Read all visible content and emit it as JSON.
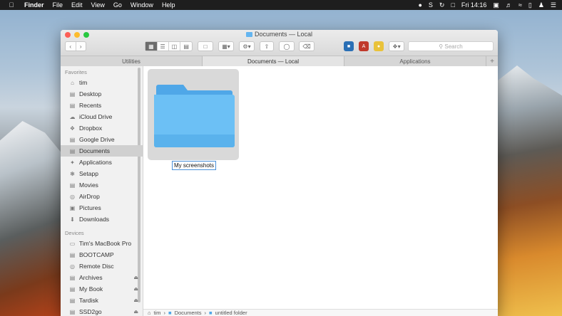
{
  "menubar": {
    "app": "Finder",
    "items": [
      "File",
      "Edit",
      "View",
      "Go",
      "Window",
      "Help"
    ],
    "clock": "Fri 14:16"
  },
  "window": {
    "title": "Documents — Local",
    "search_placeholder": "Search",
    "tabs": [
      "Utilities",
      "Documents — Local",
      "Applications"
    ],
    "tab_add": "+"
  },
  "sidebar": {
    "favorites_header": "Favorites",
    "favorites": [
      "tim",
      "Desktop",
      "Recents",
      "iCloud Drive",
      "Dropbox",
      "Google Drive",
      "Documents",
      "Applications",
      "Setapp",
      "Movies",
      "AirDrop",
      "Pictures",
      "Downloads"
    ],
    "selected": "Documents",
    "devices_header": "Devices",
    "devices": [
      "Tim's MacBook Pro",
      "BOOTCAMP",
      "Remote Disc",
      "Archives",
      "My Book",
      "Tardisk",
      "SSD2go"
    ]
  },
  "content": {
    "folder_name": "My screenshots"
  },
  "pathbar": [
    "tim",
    "Documents",
    "untitled folder"
  ],
  "colors": {
    "folder_blue": "#64b5f0",
    "selection_blue": "#4a90d9"
  }
}
